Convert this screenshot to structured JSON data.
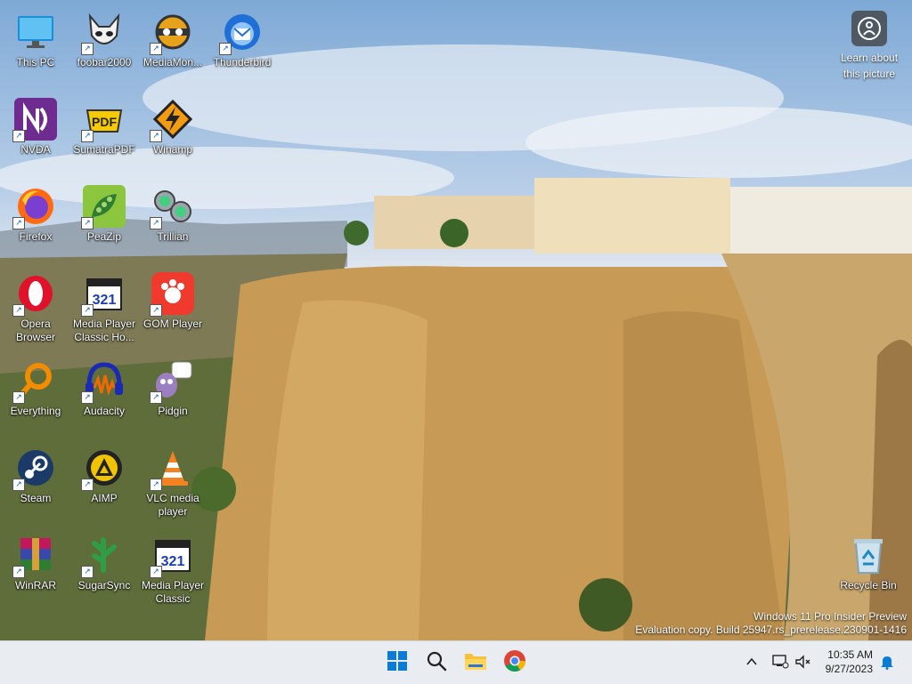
{
  "desktop": {
    "icons": [
      {
        "label": "This PC",
        "icon": "computer-icon"
      },
      {
        "label": "foobar2000",
        "icon": "foobar-icon"
      },
      {
        "label": "MediaMon...",
        "icon": "mediamonkey-icon"
      },
      {
        "label": "Thunderbird",
        "icon": "thunderbird-icon"
      },
      {
        "label": "NVDA",
        "icon": "nvda-icon"
      },
      {
        "label": "SumatraPDF",
        "icon": "sumatrapdf-icon"
      },
      {
        "label": "Winamp",
        "icon": "winamp-icon"
      },
      {
        "label": "Firefox",
        "icon": "firefox-icon"
      },
      {
        "label": "PeaZip",
        "icon": "peazip-icon"
      },
      {
        "label": "Trillian",
        "icon": "trillian-icon"
      },
      {
        "label": "Opera Browser",
        "icon": "opera-icon"
      },
      {
        "label": "Media Player Classic Ho...",
        "icon": "mpc-hc-icon"
      },
      {
        "label": "GOM Player",
        "icon": "gom-player-icon"
      },
      {
        "label": "Everything",
        "icon": "everything-icon"
      },
      {
        "label": "Audacity",
        "icon": "audacity-icon"
      },
      {
        "label": "Pidgin",
        "icon": "pidgin-icon"
      },
      {
        "label": "Steam",
        "icon": "steam-icon"
      },
      {
        "label": "AIMP",
        "icon": "aimp-icon"
      },
      {
        "label": "VLC media player",
        "icon": "vlc-icon"
      },
      {
        "label": "WinRAR",
        "icon": "winrar-icon"
      },
      {
        "label": "SugarSync",
        "icon": "sugarsync-icon"
      },
      {
        "label": "Media Player Classic",
        "icon": "mpc-icon"
      },
      {
        "label": "Recycle Bin",
        "icon": "recycle-bin-icon"
      }
    ],
    "learn_about_picture": "Learn about this picture",
    "watermark_line1": "Windows 11 Pro Insider Preview",
    "watermark_line2": "Evaluation copy. Build 25947.rs_prerelease.230901-1416"
  },
  "taskbar": {
    "pinned": [
      "start-icon",
      "search-icon",
      "file-explorer-icon",
      "chrome-icon"
    ],
    "time": "10:35 AM",
    "date": "9/27/2023"
  }
}
